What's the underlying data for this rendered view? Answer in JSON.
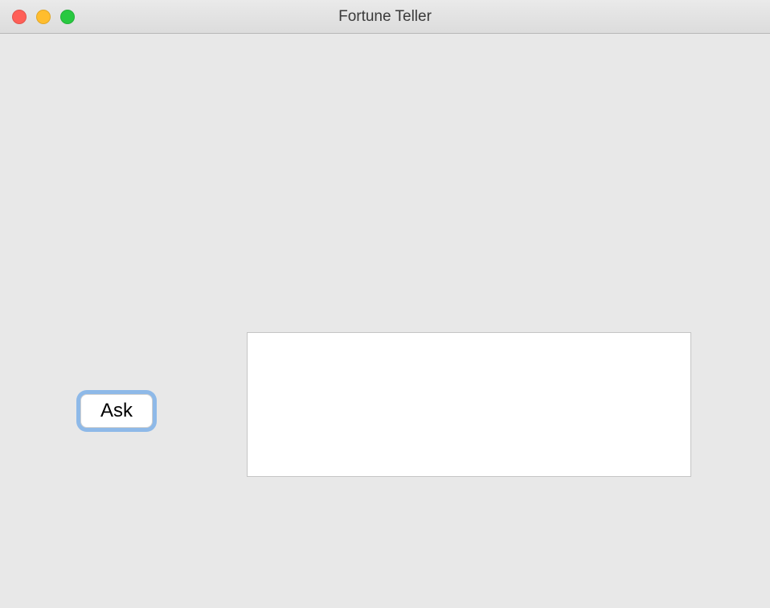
{
  "window": {
    "title": "Fortune Teller"
  },
  "buttons": {
    "ask_label": "Ask"
  },
  "output": {
    "text": ""
  }
}
